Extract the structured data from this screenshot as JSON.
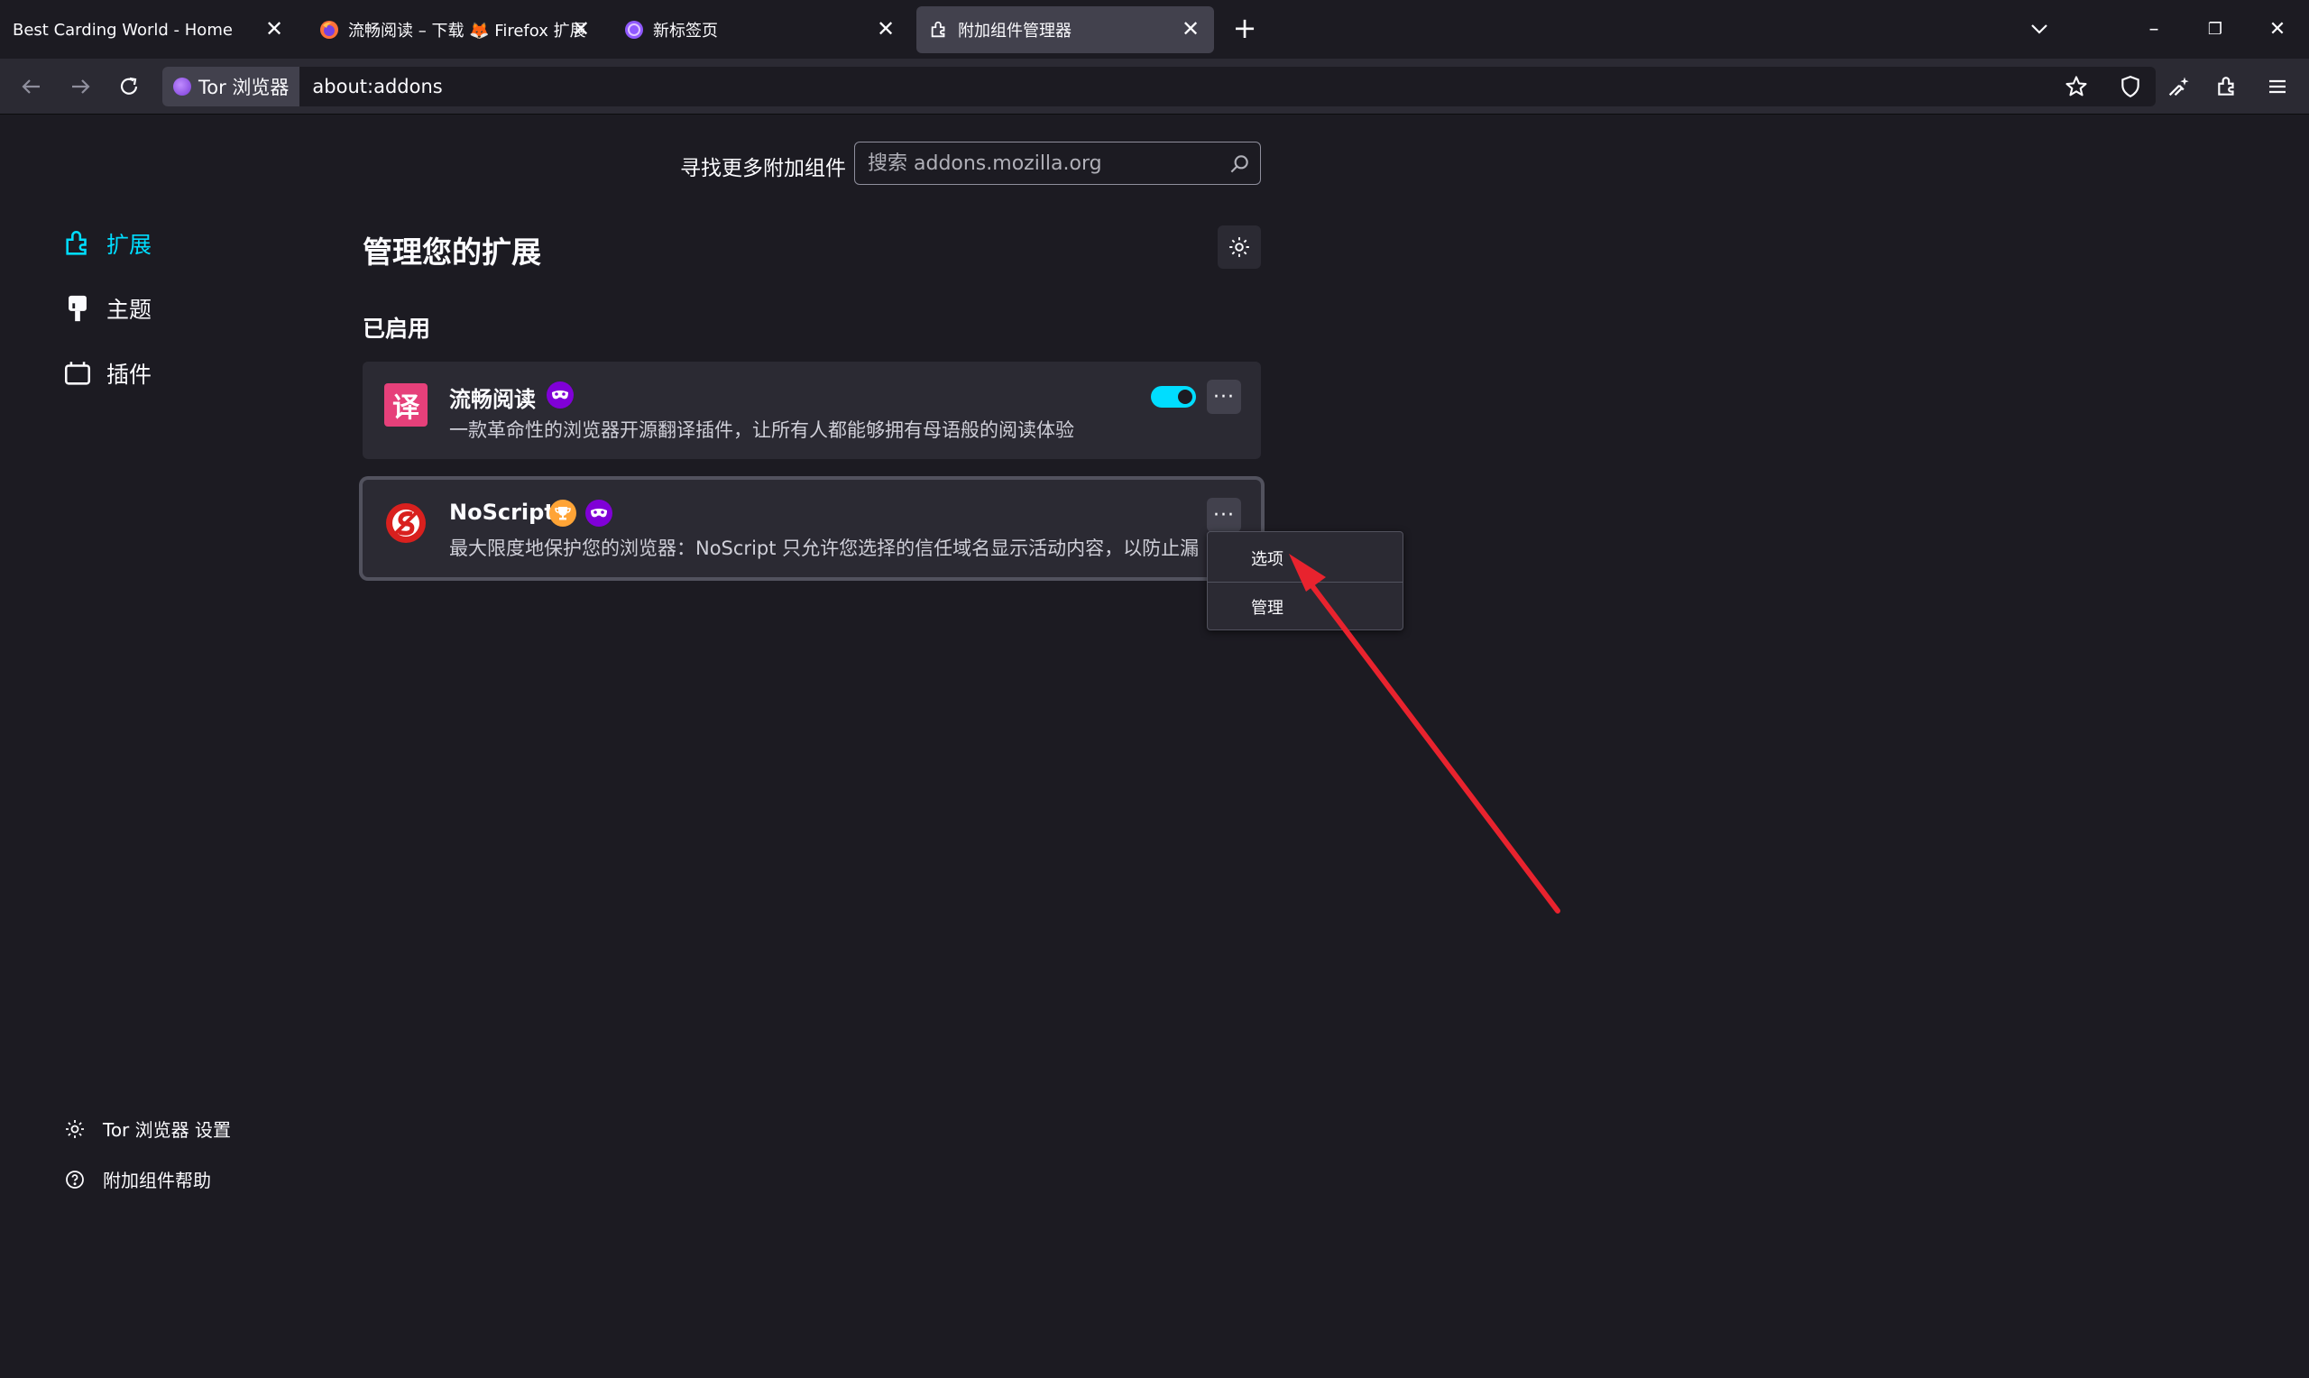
{
  "tabs": [
    {
      "label": "Best Carding World - Home",
      "close": "✕",
      "favicon": "none"
    },
    {
      "label": "流畅阅读 – 下载 🦊 Firefox 扩展",
      "close": "✕",
      "favicon": "firefox-icon"
    },
    {
      "label": "新标签页",
      "close": "✕",
      "favicon": "tor-onion-icon"
    },
    {
      "label": "附加组件管理器",
      "close": "✕",
      "favicon": "puzzle-icon"
    }
  ],
  "new_tab": "+",
  "window_controls": {
    "minimize": "–",
    "restore": "❐",
    "close": "✕"
  },
  "navbar": {
    "identity_label": "Tor 浏览器",
    "url": "about:addons"
  },
  "search": {
    "label": "寻找更多附加组件",
    "placeholder": "搜索 addons.mozilla.org"
  },
  "sidebar": {
    "categories": [
      {
        "label": "扩展",
        "icon": "puzzle-icon",
        "selected": true
      },
      {
        "label": "主题",
        "icon": "brush-icon",
        "selected": false
      },
      {
        "label": "插件",
        "icon": "plugin-icon",
        "selected": false
      }
    ],
    "footer": [
      {
        "label": "Tor 浏览器 设置",
        "icon": "gear-icon"
      },
      {
        "label": "附加组件帮助",
        "icon": "help-icon"
      }
    ]
  },
  "main": {
    "title": "管理您的扩展",
    "section": "已启用",
    "addons": [
      {
        "name": "流畅阅读",
        "icon_text": "译",
        "description": "一款革命性的浏览器开源翻译插件，让所有人都能够拥有母语般的阅读体验",
        "enabled": true
      },
      {
        "name": "NoScript",
        "description": "最大限度地保护您的浏览器：NoScript 只允许您选择的信任域名显示活动内容，以防止漏洞",
        "enabled": true
      }
    ],
    "more_label": "···"
  },
  "popup_menu": {
    "items": [
      "选项",
      "管理"
    ]
  },
  "colors": {
    "accent": "#00ddff",
    "annotation_arrow": "#e8232e",
    "private_badge": "#8000d7",
    "recommended_badge": "#ffa436"
  }
}
